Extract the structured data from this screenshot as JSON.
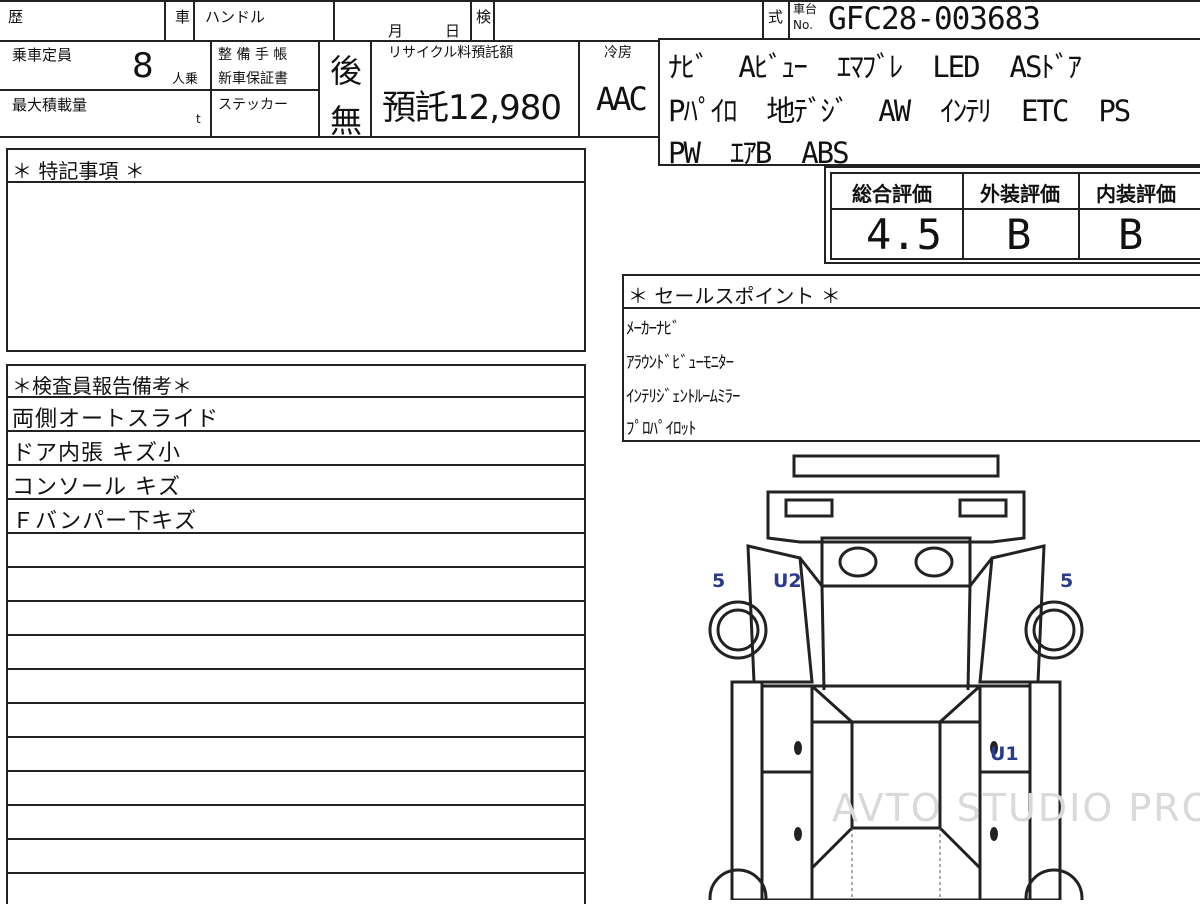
{
  "header": {
    "history_label": "歴",
    "car_label": "車",
    "handle_label": "ハンドル",
    "month_label": "月",
    "day_label": "日",
    "inspection_label": "検",
    "type_label": "式",
    "chassis_label_top": "車台",
    "chassis_label_bottom": "No.",
    "chassis_number": "GFC28-003683"
  },
  "specs": {
    "capacity_label": "乗車定員",
    "capacity_value": "8",
    "capacity_unit": "人乗",
    "max_load_label": "最大積載量",
    "max_load_unit": "t",
    "maintenance_label_1": "整 備 手 帳",
    "maintenance_label_2": "新車保証書",
    "maintenance_value": "後",
    "sticker_label": "ステッカー",
    "sticker_value": "無",
    "recycle_label": "リサイクル料預託額",
    "recycle_value": "預託12,980",
    "ac_label": "冷房",
    "ac_value": "AAC"
  },
  "equipment": {
    "lines": [
      "ﾅﾋﾞ  Aﾋﾞｭｰ  ｴﾏﾌﾞﾚ  LED  ASﾄﾞｱ",
      "Pﾊﾟｲﾛ  地ﾃﾞｼﾞ  AW  ｲﾝﾃﾘ  ETC  PS",
      "PW  ｴｱB  ABS"
    ]
  },
  "ratings": {
    "overall_label": "総合評価",
    "overall_value": "4.5",
    "exterior_label": "外装評価",
    "exterior_value": "B",
    "interior_label": "内装評価",
    "interior_value": "B"
  },
  "special_notes": {
    "title": "＊ 特記事項 ＊"
  },
  "sales_points": {
    "title": "＊ セールスポイント ＊",
    "items": [
      "ﾒｰｶｰﾅﾋﾞ",
      "ｱﾗｳﾝﾄﾞﾋﾞｭｰﾓﾆﾀｰ",
      "ｲﾝﾃﾘｼﾞｪﾝﾄﾙｰﾑﾐﾗｰ",
      "ﾌﾟﾛﾊﾟｲﾛｯﾄ"
    ]
  },
  "inspector_remarks": {
    "title": "＊検査員報告備考＊",
    "items": [
      "両側オートスライド",
      "ドア内張 キズ小",
      "コンソール キズ",
      "Ｆバンパー下キズ"
    ]
  },
  "damage_marks": {
    "front_left_tire": "5",
    "front_left_fender": "U2",
    "front_right_tire": "5",
    "right_side": "U1"
  },
  "watermark": "AVTO STUDIO PRO",
  "colors": {
    "line": "#222222",
    "damage_mark": "#2a3a8c",
    "watermark": "#d9d9d9"
  }
}
